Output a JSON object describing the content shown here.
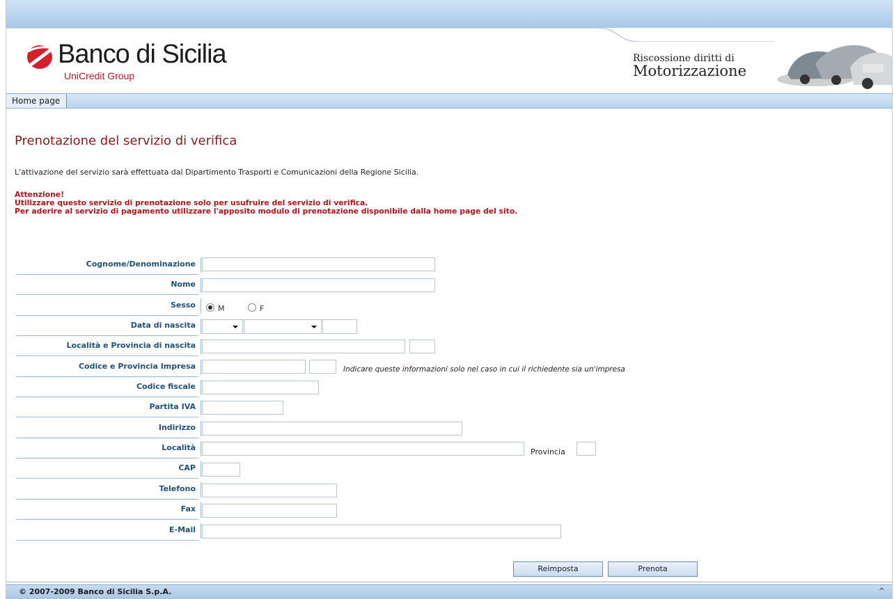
{
  "header": {
    "brand": "Banco di Sicilia",
    "brand_sub": "UniCredit Group",
    "service_line1": "Riscossione diritti di",
    "service_line2": "Motorizzazione"
  },
  "nav": {
    "home": "Home page"
  },
  "page": {
    "title": "Prenotazione del servizio di verifica",
    "intro": "L'attivazione del servizio sarà effettuata dal Dipartimento Trasporti e Comunicazioni della Regione Sicilia.",
    "warning_title": "Attenzione!",
    "warning_line1": "Utilizzare questo servizio di prenotazione solo per usufruire del servizio di verifica.",
    "warning_line2": "Per aderire al servizio di pagamento utilizzare l'apposito modulo di prenotazione disponibile dalla home page del sito."
  },
  "form": {
    "cognome": "Cognome/Denominazione",
    "nome": "Nome",
    "sesso": "Sesso",
    "sesso_m": "M",
    "sesso_f": "F",
    "data_nascita": "Data di nascita",
    "localita_nascita": "Località e Provincia di nascita",
    "codice_impresa": "Codice e Provincia Impresa",
    "impresa_note": "Indicare queste informazioni solo nel caso in cui il richiedente sia un'impresa",
    "codice_fiscale": "Codice fiscale",
    "partita_iva": "Partita IVA",
    "indirizzo": "Indirizzo",
    "localita": "Località",
    "provincia": "Provincia",
    "cap": "CAP",
    "telefono": "Telefono",
    "fax": "Fax",
    "email": "E-Mail"
  },
  "buttons": {
    "reset": "Reimposta",
    "submit": "Prenota"
  },
  "footer": {
    "copyright": "© 2007-2009 Banco di Sicilia S.p.A.",
    "top": "^"
  },
  "colors": {
    "brand_red": "#c8102e",
    "title_red": "#8b1a1a",
    "label_blue": "#1f4f7c",
    "band_blue": "#b9d4ee"
  }
}
